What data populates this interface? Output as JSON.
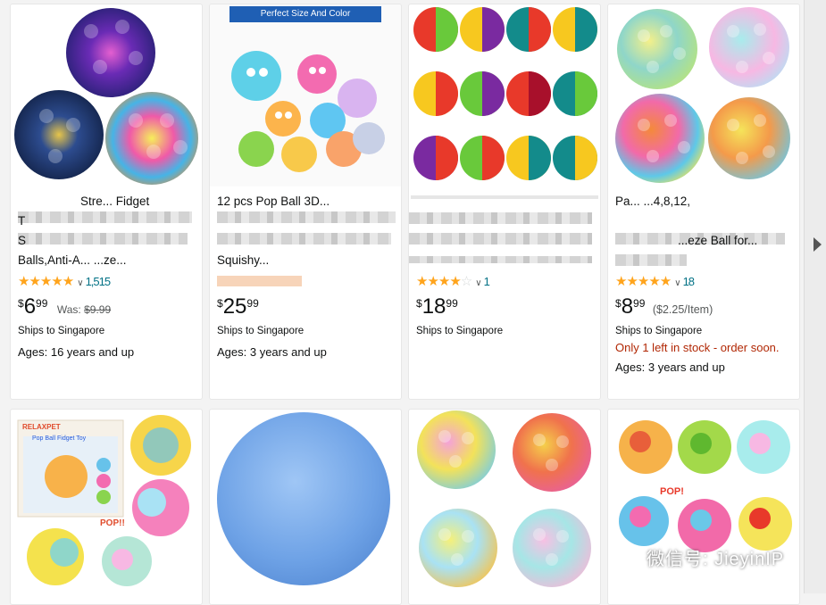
{
  "products": [
    {
      "title_lines": [
        "Stre... Fidget",
        "T",
        "S",
        "Balls,Anti-A... ...ze..."
      ],
      "rating_stars": 4.5,
      "review_count": "1,515",
      "price": {
        "symbol": "$",
        "whole": "6",
        "fraction": "99"
      },
      "was": {
        "label": "Was:",
        "value": "$9.99"
      },
      "ships": "Ships to Singapore",
      "ages": "Ages: 16 years and up"
    },
    {
      "banner": "Perfect Size And Color",
      "title_lines": [
        "12 pcs Pop Ball 3D...",
        "Squishy..."
      ],
      "price": {
        "symbol": "$",
        "whole": "25",
        "fraction": "99"
      },
      "ships": "Ships to Singapore",
      "ages": "Ages: 3 years and up"
    },
    {
      "title_lines": [],
      "rating_stars": 4,
      "review_count": "1",
      "price": {
        "symbol": "$",
        "whole": "18",
        "fraction": "99"
      },
      "ships": "Ships to Singapore"
    },
    {
      "title_lines": [
        "Pa... ...4,8,12,",
        "...eze Ball for..."
      ],
      "rating_stars": 4.5,
      "review_count": "18",
      "price": {
        "symbol": "$",
        "whole": "8",
        "fraction": "99"
      },
      "unit_price": "($2.25/Item)",
      "ships": "Ships to Singapore",
      "stock": "Only 1 left in stock - order soon.",
      "ages": "Ages: 3 years and up"
    },
    {
      "box_text": [
        "RELAXPET",
        "Pop Ball Fidget Toy"
      ],
      "burst": "POP!!"
    },
    {},
    {},
    {
      "burst": "POP!"
    }
  ],
  "watermark": "微信号: JieyinIP",
  "colors": {
    "star": "#ffa41c",
    "link": "#007185",
    "stock": "#b12704",
    "banner": "#1f5fb4"
  }
}
